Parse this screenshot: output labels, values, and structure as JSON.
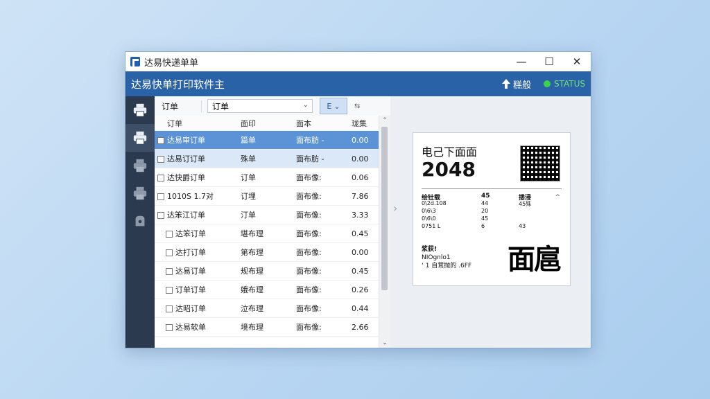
{
  "window": {
    "title": "达易快递单单",
    "controls": {
      "minimize": "—",
      "maximize": "☐",
      "close": "✕"
    }
  },
  "header": {
    "title": "达易快单打印软件主",
    "upload_label": "糕般",
    "status_label": "STATUS"
  },
  "sidebar": {
    "items": [
      {
        "icon": "printer-icon"
      },
      {
        "icon": "printer-icon",
        "active": true
      },
      {
        "icon": "printer-icon"
      },
      {
        "icon": "printer-icon"
      },
      {
        "icon": "bag-icon"
      }
    ]
  },
  "toolbar": {
    "label": "订单",
    "select_value": "订单",
    "filter_label": "E"
  },
  "table": {
    "columns": [
      "订单",
      "面印",
      "面本",
      "珑集"
    ],
    "rows": [
      {
        "c1": "达易审订单",
        "c2": "篇单",
        "c3": "面布肪 -",
        "c4": "0.00",
        "state": "selected"
      },
      {
        "c1": "达易订订单",
        "c2": "殊单",
        "c3": "面布肪 -",
        "c4": "0.00",
        "state": "highlight"
      },
      {
        "c1": "达快爵订单",
        "c2": "订单",
        "c3": "面布像:",
        "c4": "0.06"
      },
      {
        "c1": "1010S 1.7对",
        "c2": "订埋",
        "c3": "面布像:",
        "c4": "7.86"
      },
      {
        "c1": "达笨江订单",
        "c2": "汀单",
        "c3": "面布像:",
        "c4": "3.33"
      },
      {
        "c1": "达笨订单",
        "c2": "堪布理",
        "c3": "面布像:",
        "c4": "0.45",
        "indent": true
      },
      {
        "c1": "达打订单",
        "c2": "第布理",
        "c3": "面布像:",
        "c4": "0.00",
        "indent": true
      },
      {
        "c1": "达易订单",
        "c2": "规布理",
        "c3": "面布像:",
        "c4": "0.45",
        "indent": true
      },
      {
        "c1": "订单订单",
        "c2": "娥布理",
        "c3": "面布像:",
        "c4": "0.26",
        "indent": true
      },
      {
        "c1": "达昭订单",
        "c2": "泣布理",
        "c3": "面布像:",
        "c4": "0.44",
        "indent": true
      },
      {
        "c1": "达易软单",
        "c2": "境布理",
        "c3": "面布像:",
        "c4": "2.66",
        "indent": true
      }
    ]
  },
  "preview": {
    "title": "电己下面面",
    "number": "2048",
    "grid_head": [
      "绘钍载",
      "45",
      "搂浸"
    ],
    "grid_rows": [
      [
        "0\\2d.108",
        "44",
        "45殊"
      ],
      [
        "0\\6\\3",
        "20",
        ""
      ],
      [
        "0\\6\\0",
        "45",
        ""
      ],
      [
        "0751 L",
        "6",
        "43"
      ]
    ],
    "bottom_lines": [
      "浆荻!",
      "NIOgnlo1",
      "‘ 1 自茸抛的 .6FF"
    ],
    "big_char": "面扈"
  }
}
